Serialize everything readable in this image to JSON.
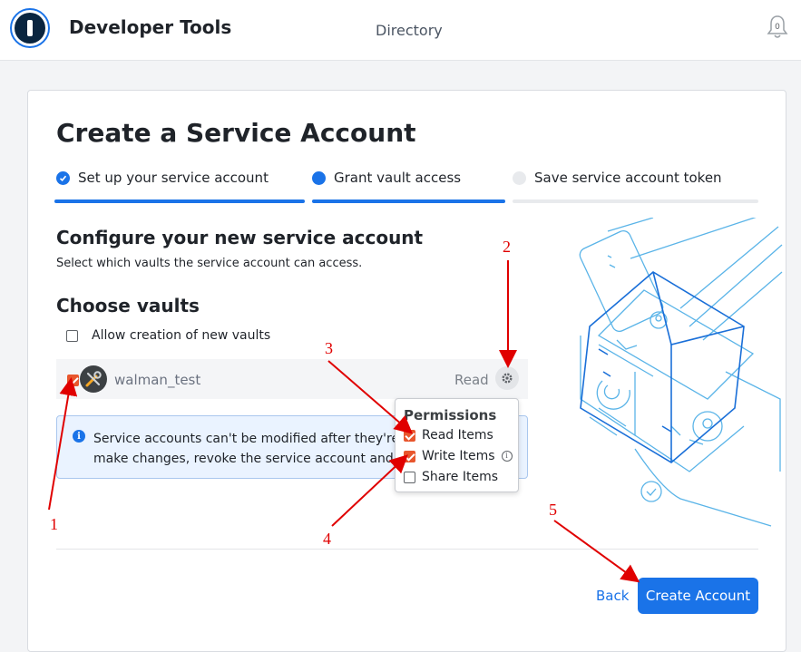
{
  "header": {
    "app_title": "Developer Tools",
    "nav_directory": "Directory",
    "notification_count": "0"
  },
  "page": {
    "title": "Create a Service Account"
  },
  "stepper": {
    "steps": [
      {
        "label": "Set up your service account",
        "state": "done"
      },
      {
        "label": "Grant vault access",
        "state": "current"
      },
      {
        "label": "Save service account token",
        "state": "upcoming"
      }
    ]
  },
  "configure": {
    "title": "Configure your new service account",
    "subtitle": "Select which vaults the service account can access."
  },
  "vaults": {
    "title": "Choose vaults",
    "allow_new_label": "Allow creation of new vaults",
    "allow_new_checked": false,
    "items": [
      {
        "name": "walman_test",
        "permission": "Read",
        "checked": true
      }
    ]
  },
  "info": {
    "line1": "Service accounts can't be modified after they're crea",
    "line2": "make changes, revoke the service account and crea"
  },
  "permissions_popup": {
    "title": "Permissions",
    "items": [
      {
        "label": "Read Items",
        "checked": true
      },
      {
        "label": "Write Items",
        "checked": true,
        "has_info": true
      },
      {
        "label": "Share Items",
        "checked": false
      }
    ]
  },
  "footer": {
    "back_label": "Back",
    "create_label": "Create Account"
  },
  "annotations": [
    "1",
    "2",
    "3",
    "4",
    "5"
  ],
  "colors": {
    "accent": "#1a73e8",
    "checkbox_checked": "#e8562d",
    "annotation": "#e00000"
  }
}
